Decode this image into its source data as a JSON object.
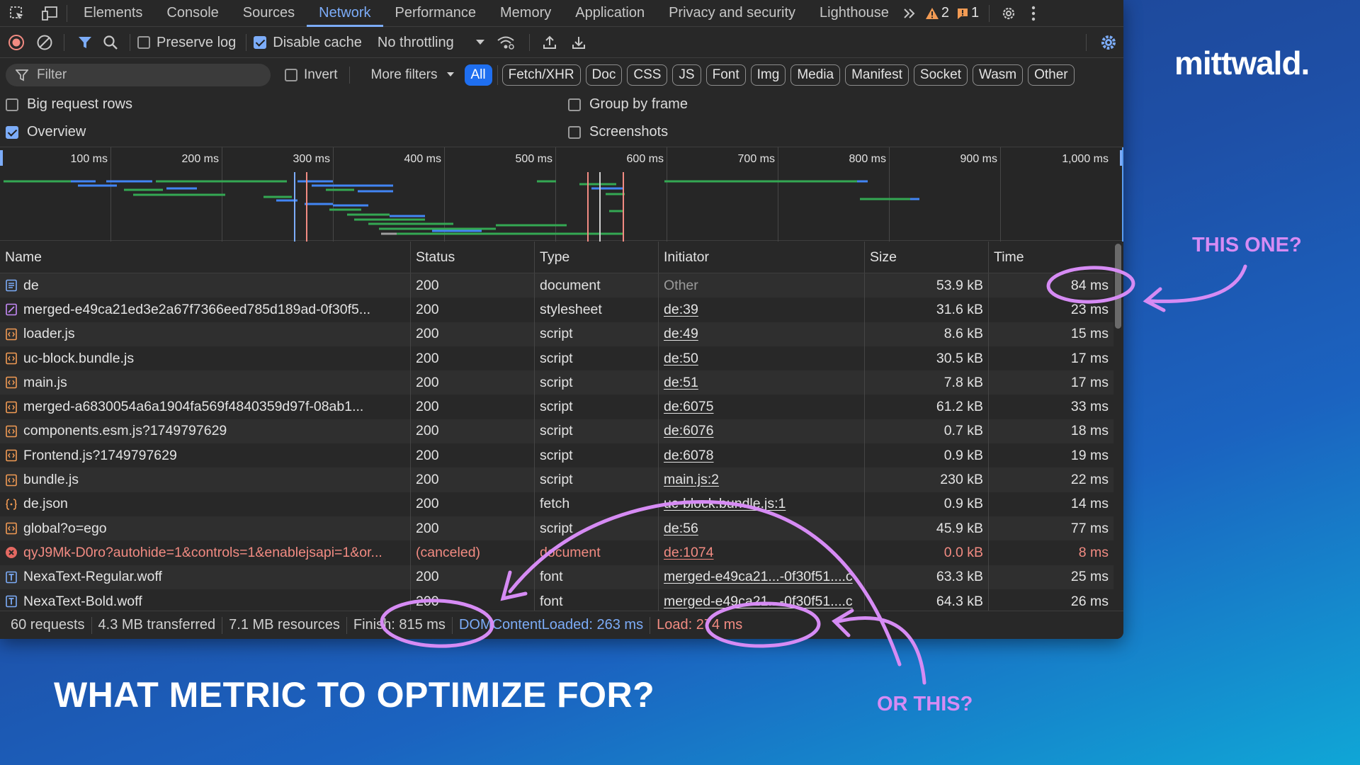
{
  "tabs": [
    "Elements",
    "Console",
    "Sources",
    "Network",
    "Performance",
    "Memory",
    "Application",
    "Privacy and security",
    "Lighthouse"
  ],
  "active_tab": "Network",
  "badges": {
    "warnings": "2",
    "issues": "1"
  },
  "toolbar": {
    "preserve_log": "Preserve log",
    "disable_cache": "Disable cache",
    "throttling": "No throttling"
  },
  "filterbar": {
    "filter_placeholder": "Filter",
    "invert": "Invert",
    "more_filters": "More filters",
    "types": [
      "All",
      "Fetch/XHR",
      "Doc",
      "CSS",
      "JS",
      "Font",
      "Img",
      "Media",
      "Manifest",
      "Socket",
      "Wasm",
      "Other"
    ]
  },
  "options": {
    "big_request_rows": "Big request rows",
    "group_by_frame": "Group by frame",
    "overview": "Overview",
    "screenshots": "Screenshots"
  },
  "overview_ticks": [
    "100 ms",
    "200 ms",
    "300 ms",
    "400 ms",
    "500 ms",
    "600 ms",
    "700 ms",
    "800 ms",
    "900 ms",
    "1,000 ms"
  ],
  "columns": [
    "Name",
    "Status",
    "Type",
    "Initiator",
    "Size",
    "Time"
  ],
  "rows": [
    {
      "icon": "document",
      "name": "de",
      "status": "200",
      "type": "document",
      "initiator": "Other",
      "size": "53.9 kB",
      "time": "84 ms"
    },
    {
      "icon": "stylesheet",
      "name": "merged-e49ca21ed3e2a67f7366eed785d189ad-0f30f5...",
      "status": "200",
      "type": "stylesheet",
      "initiator": "de:39",
      "size": "31.6 kB",
      "time": "23 ms"
    },
    {
      "icon": "script",
      "name": "loader.js",
      "status": "200",
      "type": "script",
      "initiator": "de:49",
      "size": "8.6 kB",
      "time": "15 ms"
    },
    {
      "icon": "script",
      "name": "uc-block.bundle.js",
      "status": "200",
      "type": "script",
      "initiator": "de:50",
      "size": "30.5 kB",
      "time": "17 ms"
    },
    {
      "icon": "script",
      "name": "main.js",
      "status": "200",
      "type": "script",
      "initiator": "de:51",
      "size": "7.8 kB",
      "time": "17 ms"
    },
    {
      "icon": "script",
      "name": "merged-a6830054a6a1904fa569f4840359d97f-08ab1...",
      "status": "200",
      "type": "script",
      "initiator": "de:6075",
      "size": "61.2 kB",
      "time": "33 ms"
    },
    {
      "icon": "script",
      "name": "components.esm.js?1749797629",
      "status": "200",
      "type": "script",
      "initiator": "de:6076",
      "size": "0.7 kB",
      "time": "18 ms"
    },
    {
      "icon": "script",
      "name": "Frontend.js?1749797629",
      "status": "200",
      "type": "script",
      "initiator": "de:6078",
      "size": "0.9 kB",
      "time": "19 ms"
    },
    {
      "icon": "script",
      "name": "bundle.js",
      "status": "200",
      "type": "script",
      "initiator": "main.js:2",
      "size": "230 kB",
      "time": "22 ms"
    },
    {
      "icon": "fetch",
      "name": "de.json",
      "status": "200",
      "type": "fetch",
      "initiator": "uc-block.bundle.js:1",
      "size": "0.9 kB",
      "time": "14 ms"
    },
    {
      "icon": "script",
      "name": "global?o=ego",
      "status": "200",
      "type": "script",
      "initiator": "de:56",
      "size": "45.9 kB",
      "time": "77 ms"
    },
    {
      "icon": "error",
      "name": "qyJ9Mk-D0ro?autohide=1&controls=1&enablejsapi=1&or...",
      "status": "(canceled)",
      "type": "document",
      "initiator": "de:1074",
      "size": "0.0 kB",
      "time": "8 ms"
    },
    {
      "icon": "font",
      "name": "NexaText-Regular.woff",
      "status": "200",
      "type": "font",
      "initiator": "merged-e49ca21...-0f30f51....c",
      "size": "63.3 kB",
      "time": "25 ms"
    },
    {
      "icon": "font",
      "name": "NexaText-Bold.woff",
      "status": "200",
      "type": "font",
      "initiator": "merged-e49ca21...-0f30f51....c",
      "size": "64.3 kB",
      "time": "26 ms"
    }
  ],
  "statusbar": {
    "requests": "60 requests",
    "transferred": "4.3 MB transferred",
    "resources": "7.1 MB resources",
    "finish": "Finish: 815 ms",
    "dcl": "DOMContentLoaded: 263 ms",
    "load": "Load: 274 ms"
  },
  "brand": "mittwald.",
  "headline": "WHAT METRIC TO OPTIMIZE FOR?",
  "annotations": {
    "this_one": "THIS ONE?",
    "or_this": "OR THIS?"
  },
  "colors": {
    "accent": "#7cacf8",
    "error": "#f28b82",
    "annotation": "#d68bf4",
    "script_icon": "#f29b54",
    "stylesheet_icon": "#c58af9"
  }
}
